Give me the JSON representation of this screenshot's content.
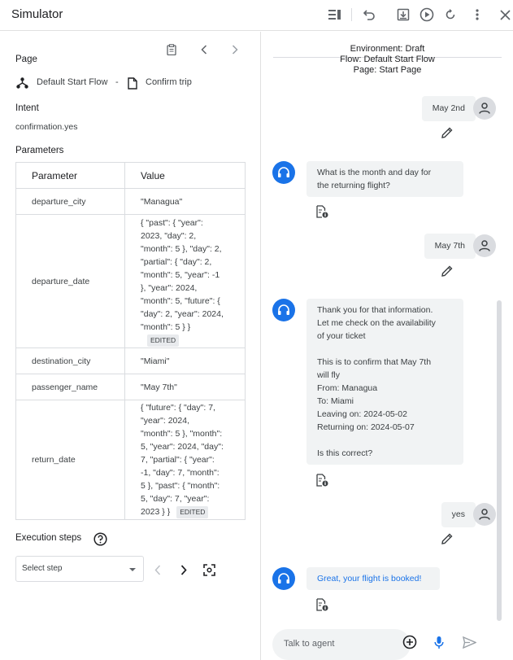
{
  "header": {
    "title": "Simulator",
    "icons": [
      "list-icon",
      "undo-icon",
      "download-icon",
      "play-icon",
      "reset-icon",
      "more-vert-icon",
      "close-icon"
    ]
  },
  "left": {
    "page_label": "Page",
    "flow_name": "Default Start Flow",
    "separator": "-",
    "page_name": "Confirm trip",
    "intent_label": "Intent",
    "intent_value": "confirmation.yes",
    "parameters_label": "Parameters",
    "table": {
      "headers": [
        "Parameter",
        "Value"
      ],
      "rows": [
        {
          "name": "departure_city",
          "lines": [
            "\"Managua\""
          ],
          "edited": ""
        },
        {
          "name": "departure_date",
          "lines": [
            "{ \"past\": { \"year\":",
            "2023, \"day\": 2,",
            "\"month\": 5 }, \"day\": 2,",
            "\"partial\": { \"day\": 2,",
            "\"month\": 5, \"year\": -1",
            "}, \"year\": 2024,",
            "\"month\": 5, \"future\": {",
            "\"day\": 2, \"year\": 2024,",
            "\"month\": 5 } }"
          ],
          "edited": "EDITED"
        },
        {
          "name": "destination_city",
          "lines": [
            "\"Miami\""
          ],
          "edited": ""
        },
        {
          "name": "passenger_name",
          "lines": [
            "\"May 7th\""
          ],
          "edited": ""
        },
        {
          "name": "return_date",
          "lines": [
            "{ \"future\": { \"day\": 7,",
            "\"year\": 2024,",
            "\"month\": 5 }, \"month\":",
            "5, \"year\": 2024, \"day\":",
            "7, \"partial\": { \"year\":",
            "-1, \"day\": 7, \"month\":",
            "5 }, \"past\": { \"month\":",
            "5, \"day\": 7, \"year\":",
            "2023 } }"
          ],
          "edited": "EDITED"
        }
      ]
    },
    "execution_label": "Execution steps",
    "select_placeholder": "Select step"
  },
  "right": {
    "env_lines": [
      "Environment: Draft",
      "Flow: Default Start Flow",
      "Page: Start Page"
    ],
    "messages": [
      {
        "role": "user",
        "text": "May 2nd"
      },
      {
        "role": "agent",
        "lines": [
          "What is the month and day for",
          "the returning flight?"
        ]
      },
      {
        "role": "user",
        "text": "May 7th"
      },
      {
        "role": "agent",
        "lines": [
          "Thank you for that information.",
          "Let me check on the availability",
          "of your ticket",
          "",
          "This is to confirm that May 7th",
          "will fly",
          "From: Managua",
          "To: Miami",
          "Leaving on: 2024-05-02",
          "Returning on: 2024-05-07",
          "",
          "Is this correct?"
        ]
      },
      {
        "role": "user",
        "text": "yes"
      },
      {
        "role": "agent",
        "lines": [
          "Great, your flight is booked!"
        ],
        "color": "#1a73e8"
      }
    ],
    "input_placeholder": "Talk to agent"
  },
  "colors": {
    "accent": "#1a73e8",
    "bubble": "#f1f3f4",
    "border": "#dadce0"
  }
}
